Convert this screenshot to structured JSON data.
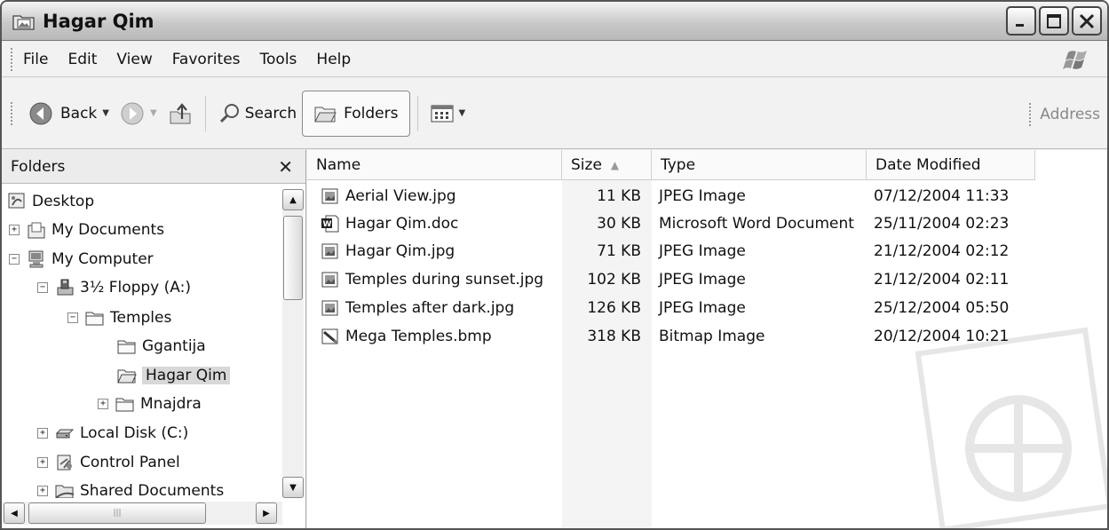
{
  "window": {
    "title": "Hagar Qim"
  },
  "menu": {
    "file": "File",
    "edit": "Edit",
    "view": "View",
    "favorites": "Favorites",
    "tools": "Tools",
    "help": "Help"
  },
  "toolbar": {
    "back": "Back",
    "search": "Search",
    "folders": "Folders",
    "address": "Address"
  },
  "folders_pane": {
    "title": "Folders",
    "tree": [
      {
        "label": "Desktop",
        "icon": "desktop-icon",
        "expander": "none"
      },
      {
        "label": "My Documents",
        "icon": "my-documents-icon",
        "expander": "+"
      },
      {
        "label": "My Computer",
        "icon": "my-computer-icon",
        "expander": "-"
      },
      {
        "label": "3½ Floppy (A:)",
        "icon": "floppy-icon",
        "expander": "-"
      },
      {
        "label": "Temples",
        "icon": "folder-icon",
        "expander": "-"
      },
      {
        "label": "Ggantija",
        "icon": "folder-icon",
        "expander": "none"
      },
      {
        "label": "Hagar Qim",
        "icon": "folder-icon",
        "expander": "none",
        "selected": true
      },
      {
        "label": "Mnajdra",
        "icon": "folder-icon",
        "expander": "+"
      },
      {
        "label": "Local Disk (C:)",
        "icon": "hard-disk-icon",
        "expander": "+"
      },
      {
        "label": "Control Panel",
        "icon": "control-panel-icon",
        "expander": "+"
      },
      {
        "label": "Shared Documents",
        "icon": "shared-documents-icon",
        "expander": "+"
      }
    ]
  },
  "list": {
    "columns": {
      "name": "Name",
      "size": "Size",
      "type": "Type",
      "date": "Date Modified"
    },
    "sorted_by": "size",
    "files": [
      {
        "name": "Aerial View.jpg",
        "size": "11 KB",
        "type": "JPEG Image",
        "date": "07/12/2004 11:33",
        "icon": "jpeg-file-icon"
      },
      {
        "name": "Hagar Qim.doc",
        "size": "30 KB",
        "type": "Microsoft Word Document",
        "date": "25/11/2004 02:23",
        "icon": "word-file-icon"
      },
      {
        "name": "Hagar Qim.jpg",
        "size": "71 KB",
        "type": "JPEG Image",
        "date": "21/12/2004 02:12",
        "icon": "jpeg-file-icon"
      },
      {
        "name": "Temples during sunset.jpg",
        "size": "102 KB",
        "type": "JPEG Image",
        "date": "21/12/2004 02:11",
        "icon": "jpeg-file-icon"
      },
      {
        "name": "Temples after dark.jpg",
        "size": "126 KB",
        "type": "JPEG Image",
        "date": "25/12/2004 05:50",
        "icon": "jpeg-file-icon"
      },
      {
        "name": "Mega Temples.bmp",
        "size": "318 KB",
        "type": "Bitmap Image",
        "date": "20/12/2004 10:21",
        "icon": "bitmap-file-icon"
      }
    ]
  }
}
